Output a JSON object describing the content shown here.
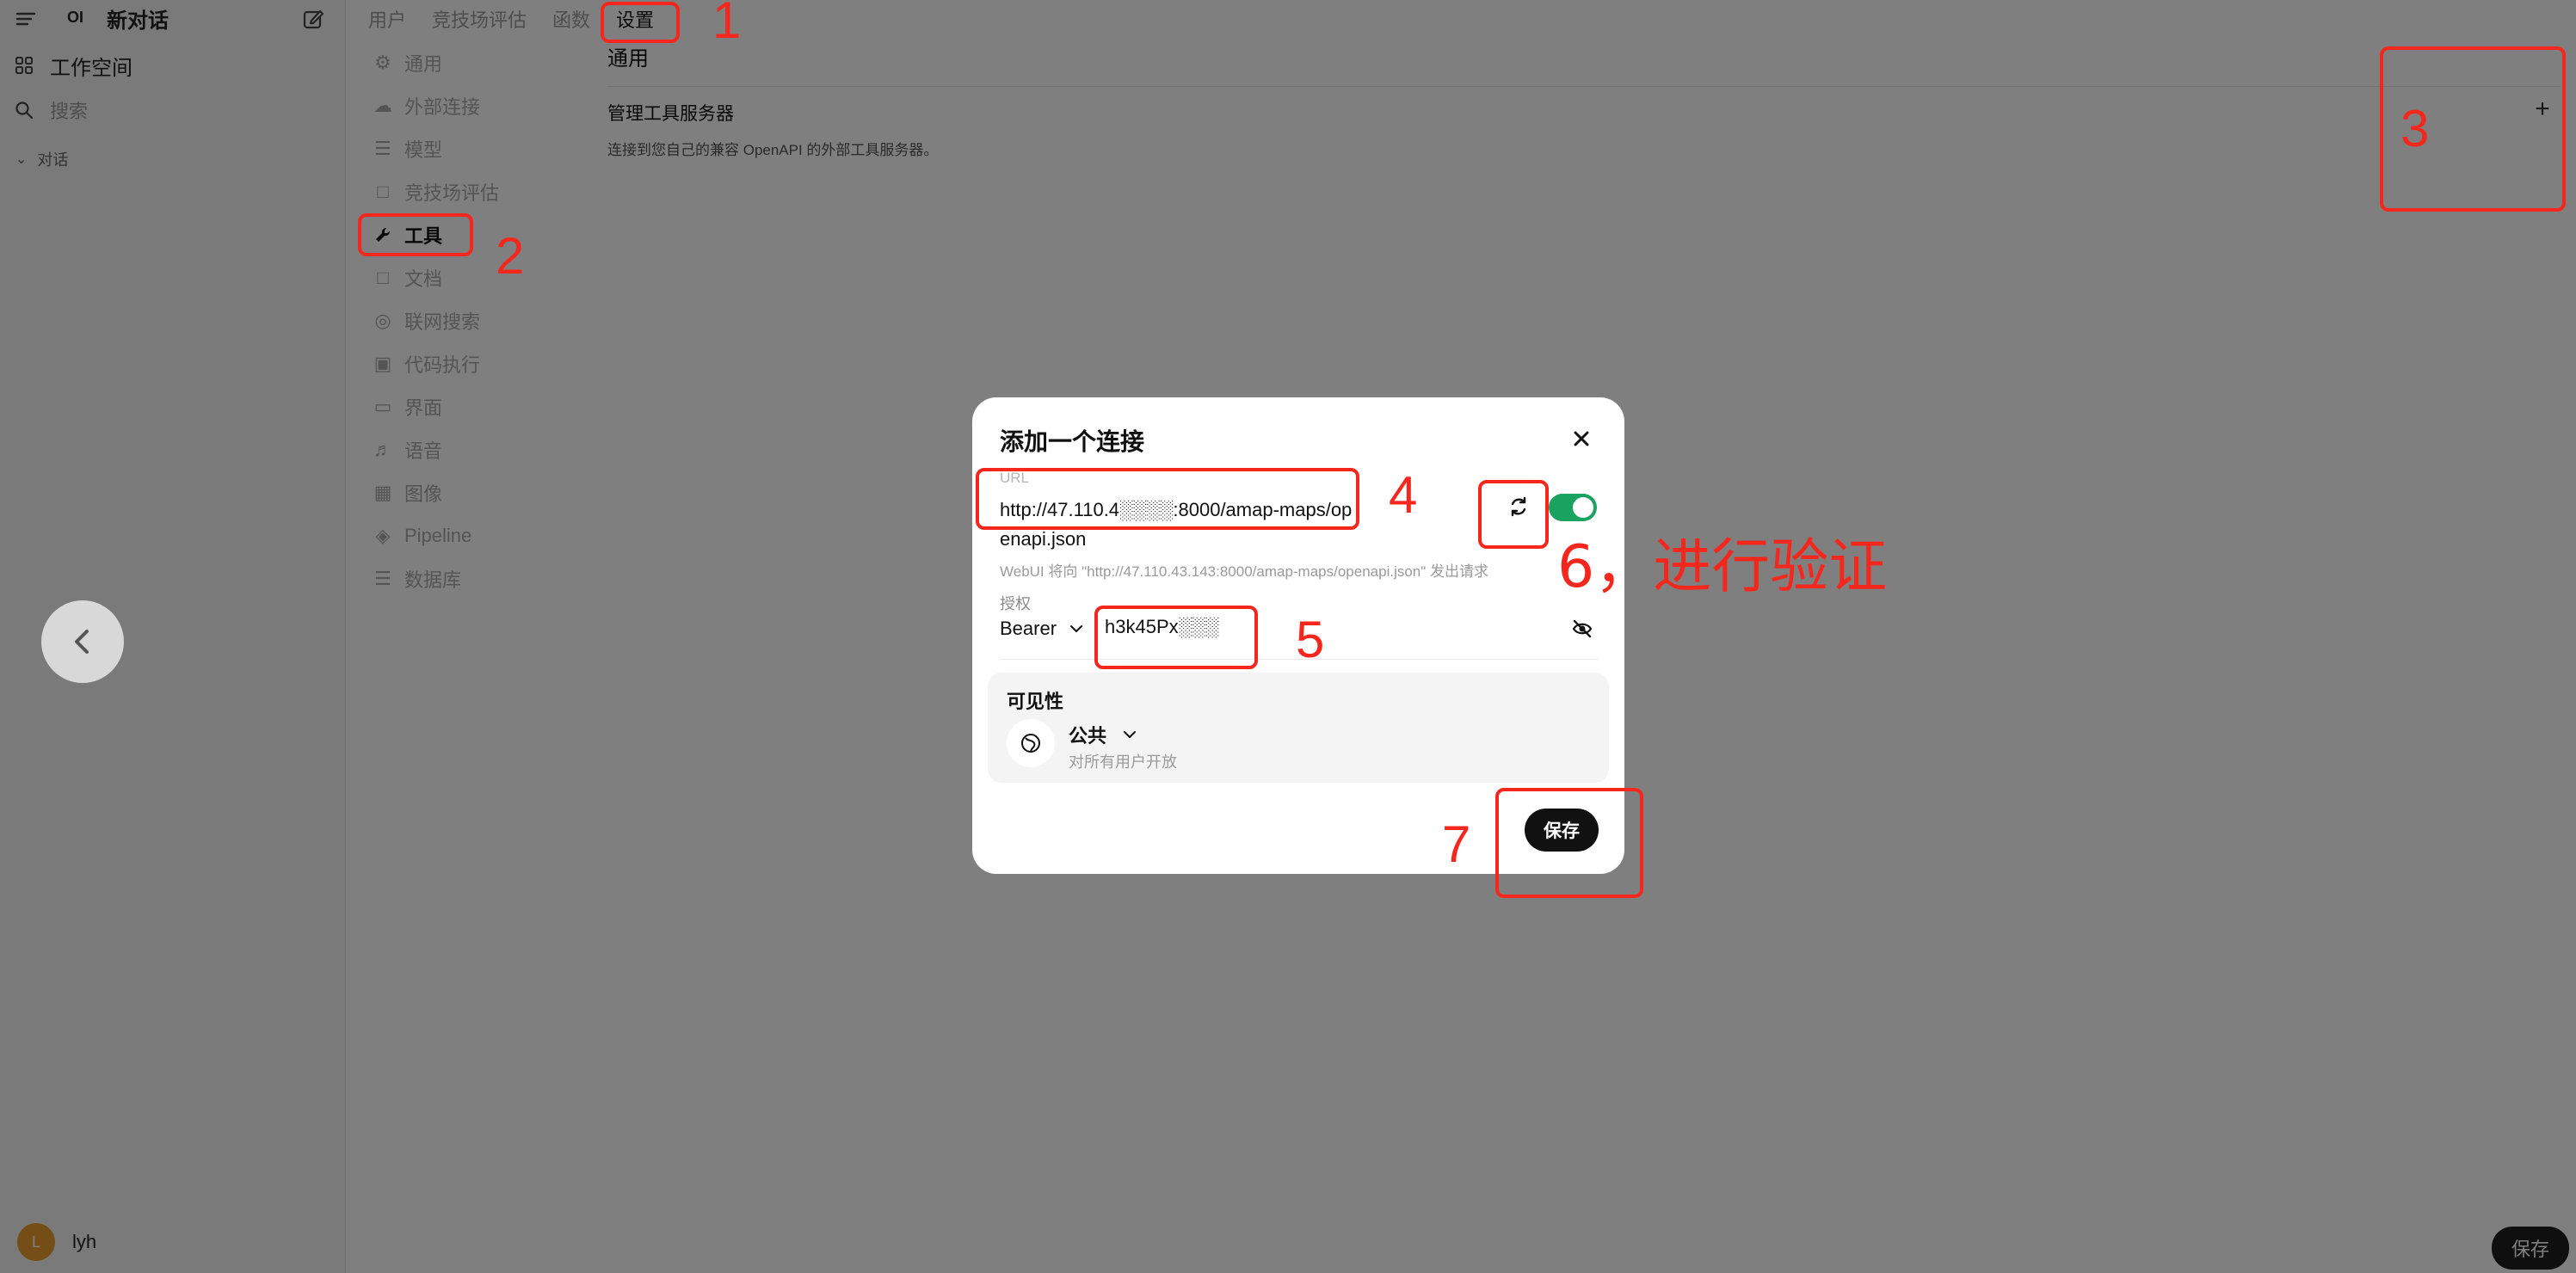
{
  "sidebar": {
    "logo": "OI",
    "new_chat": "新对话",
    "workspace": "工作空间",
    "search_placeholder": "搜索",
    "section_chats": "对话",
    "user": {
      "initial": "L",
      "name": "lyh"
    }
  },
  "topnav": {
    "tabs": [
      {
        "label": "用户"
      },
      {
        "label": "竞技场评估"
      },
      {
        "label": "函数"
      },
      {
        "label": "设置"
      }
    ]
  },
  "settings_nav": {
    "items": [
      {
        "label": "通用",
        "icon": "gear-icon"
      },
      {
        "label": "外部连接",
        "icon": "cloud-icon"
      },
      {
        "label": "模型",
        "icon": "stack-icon"
      },
      {
        "label": "竞技场评估",
        "icon": "document-icon"
      },
      {
        "label": "工具",
        "icon": "wrench-icon"
      },
      {
        "label": "文档",
        "icon": "document-icon"
      },
      {
        "label": "联网搜索",
        "icon": "globe-icon"
      },
      {
        "label": "代码执行",
        "icon": "terminal-icon"
      },
      {
        "label": "界面",
        "icon": "monitor-icon"
      },
      {
        "label": "语音",
        "icon": "speaker-icon"
      },
      {
        "label": "图像",
        "icon": "image-icon"
      },
      {
        "label": "Pipeline",
        "icon": "pipeline-icon"
      },
      {
        "label": "数据库",
        "icon": "database-icon"
      }
    ]
  },
  "main": {
    "title": "通用",
    "tool_servers_title": "管理工具服务器",
    "tool_servers_desc": "连接到您自己的兼容 OpenAPI 的外部工具服务器。",
    "add_icon": "plus-icon",
    "save_label": "保存"
  },
  "modal": {
    "title": "添加一个连接",
    "url_label": "URL",
    "url_value": "http://47.110.4░░░░:8000/amap-maps/openapi.json",
    "hint": "WebUI 将向 \"http://47.110.43.143:8000/amap-maps/openapi.json\" 发出请求",
    "auth_label": "授权",
    "auth_type": "Bearer",
    "token_value": "h3k45Px░░░",
    "enabled": true,
    "visibility_title": "可见性",
    "visibility_value": "公共",
    "visibility_desc": "对所有用户开放",
    "save_label": "保存"
  },
  "annotations": {
    "color": "#f5271c",
    "labels": [
      "1",
      "2",
      "3",
      "4",
      "5",
      "6，进行验证",
      "7"
    ]
  }
}
